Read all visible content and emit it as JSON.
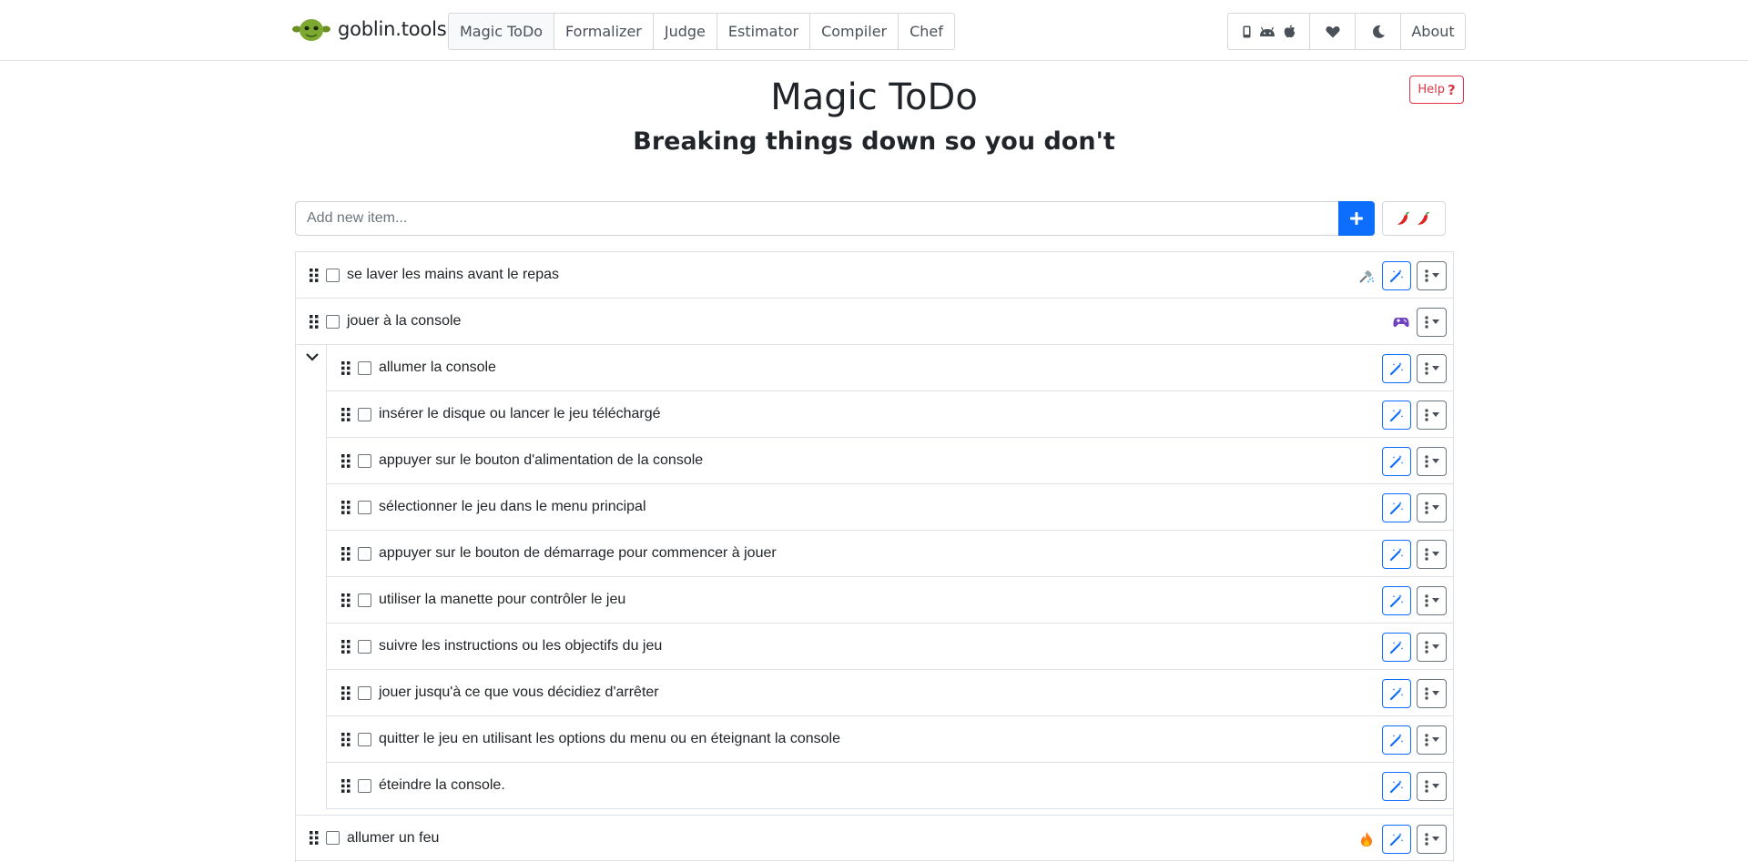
{
  "brand": {
    "name": "goblin.tools"
  },
  "nav": {
    "tools": [
      {
        "label": "Magic ToDo",
        "active": true
      },
      {
        "label": "Formalizer"
      },
      {
        "label": "Judge"
      },
      {
        "label": "Estimator"
      },
      {
        "label": "Compiler"
      },
      {
        "label": "Chef"
      }
    ],
    "right": {
      "app_icons": [
        "phone-icon",
        "android-icon",
        "apple-icon"
      ],
      "heart_icon": "heart-icon",
      "theme_icon": "moon-icon",
      "about_label": "About"
    }
  },
  "header": {
    "help_label": "Help",
    "title": "Magic ToDo",
    "subtitle": "Breaking things down so you don't"
  },
  "add": {
    "placeholder": "Add new item...",
    "add_icon": "plus-icon",
    "spiciness_icon": "chili-pepper-icon"
  },
  "colors": {
    "primary": "#0d6efd",
    "danger": "#dc3545",
    "border": "#dee2e6",
    "text": "#212529"
  },
  "tasks": [
    {
      "text": "se laver les mains avant le repas",
      "emoji": "shower-icon",
      "subtasks": []
    },
    {
      "text": "jouer à la console",
      "emoji": "game-controller-icon",
      "expanded": true,
      "subtasks": [
        {
          "text": "allumer la console"
        },
        {
          "text": "insérer le disque ou lancer le jeu téléchargé"
        },
        {
          "text": "appuyer sur le bouton d'alimentation de la console"
        },
        {
          "text": "sélectionner le jeu dans le menu principal"
        },
        {
          "text": "appuyer sur le bouton de démarrage pour commencer à jouer"
        },
        {
          "text": "utiliser la manette pour contrôler le jeu"
        },
        {
          "text": "suivre les instructions ou les objectifs du jeu"
        },
        {
          "text": "jouer jusqu'à ce que vous décidiez d'arrêter"
        },
        {
          "text": "quitter le jeu en utilisant les options du menu ou en éteignant la console"
        },
        {
          "text": "éteindre la console."
        }
      ]
    },
    {
      "text": "allumer un feu",
      "emoji": "fire-icon",
      "subtasks": []
    }
  ]
}
